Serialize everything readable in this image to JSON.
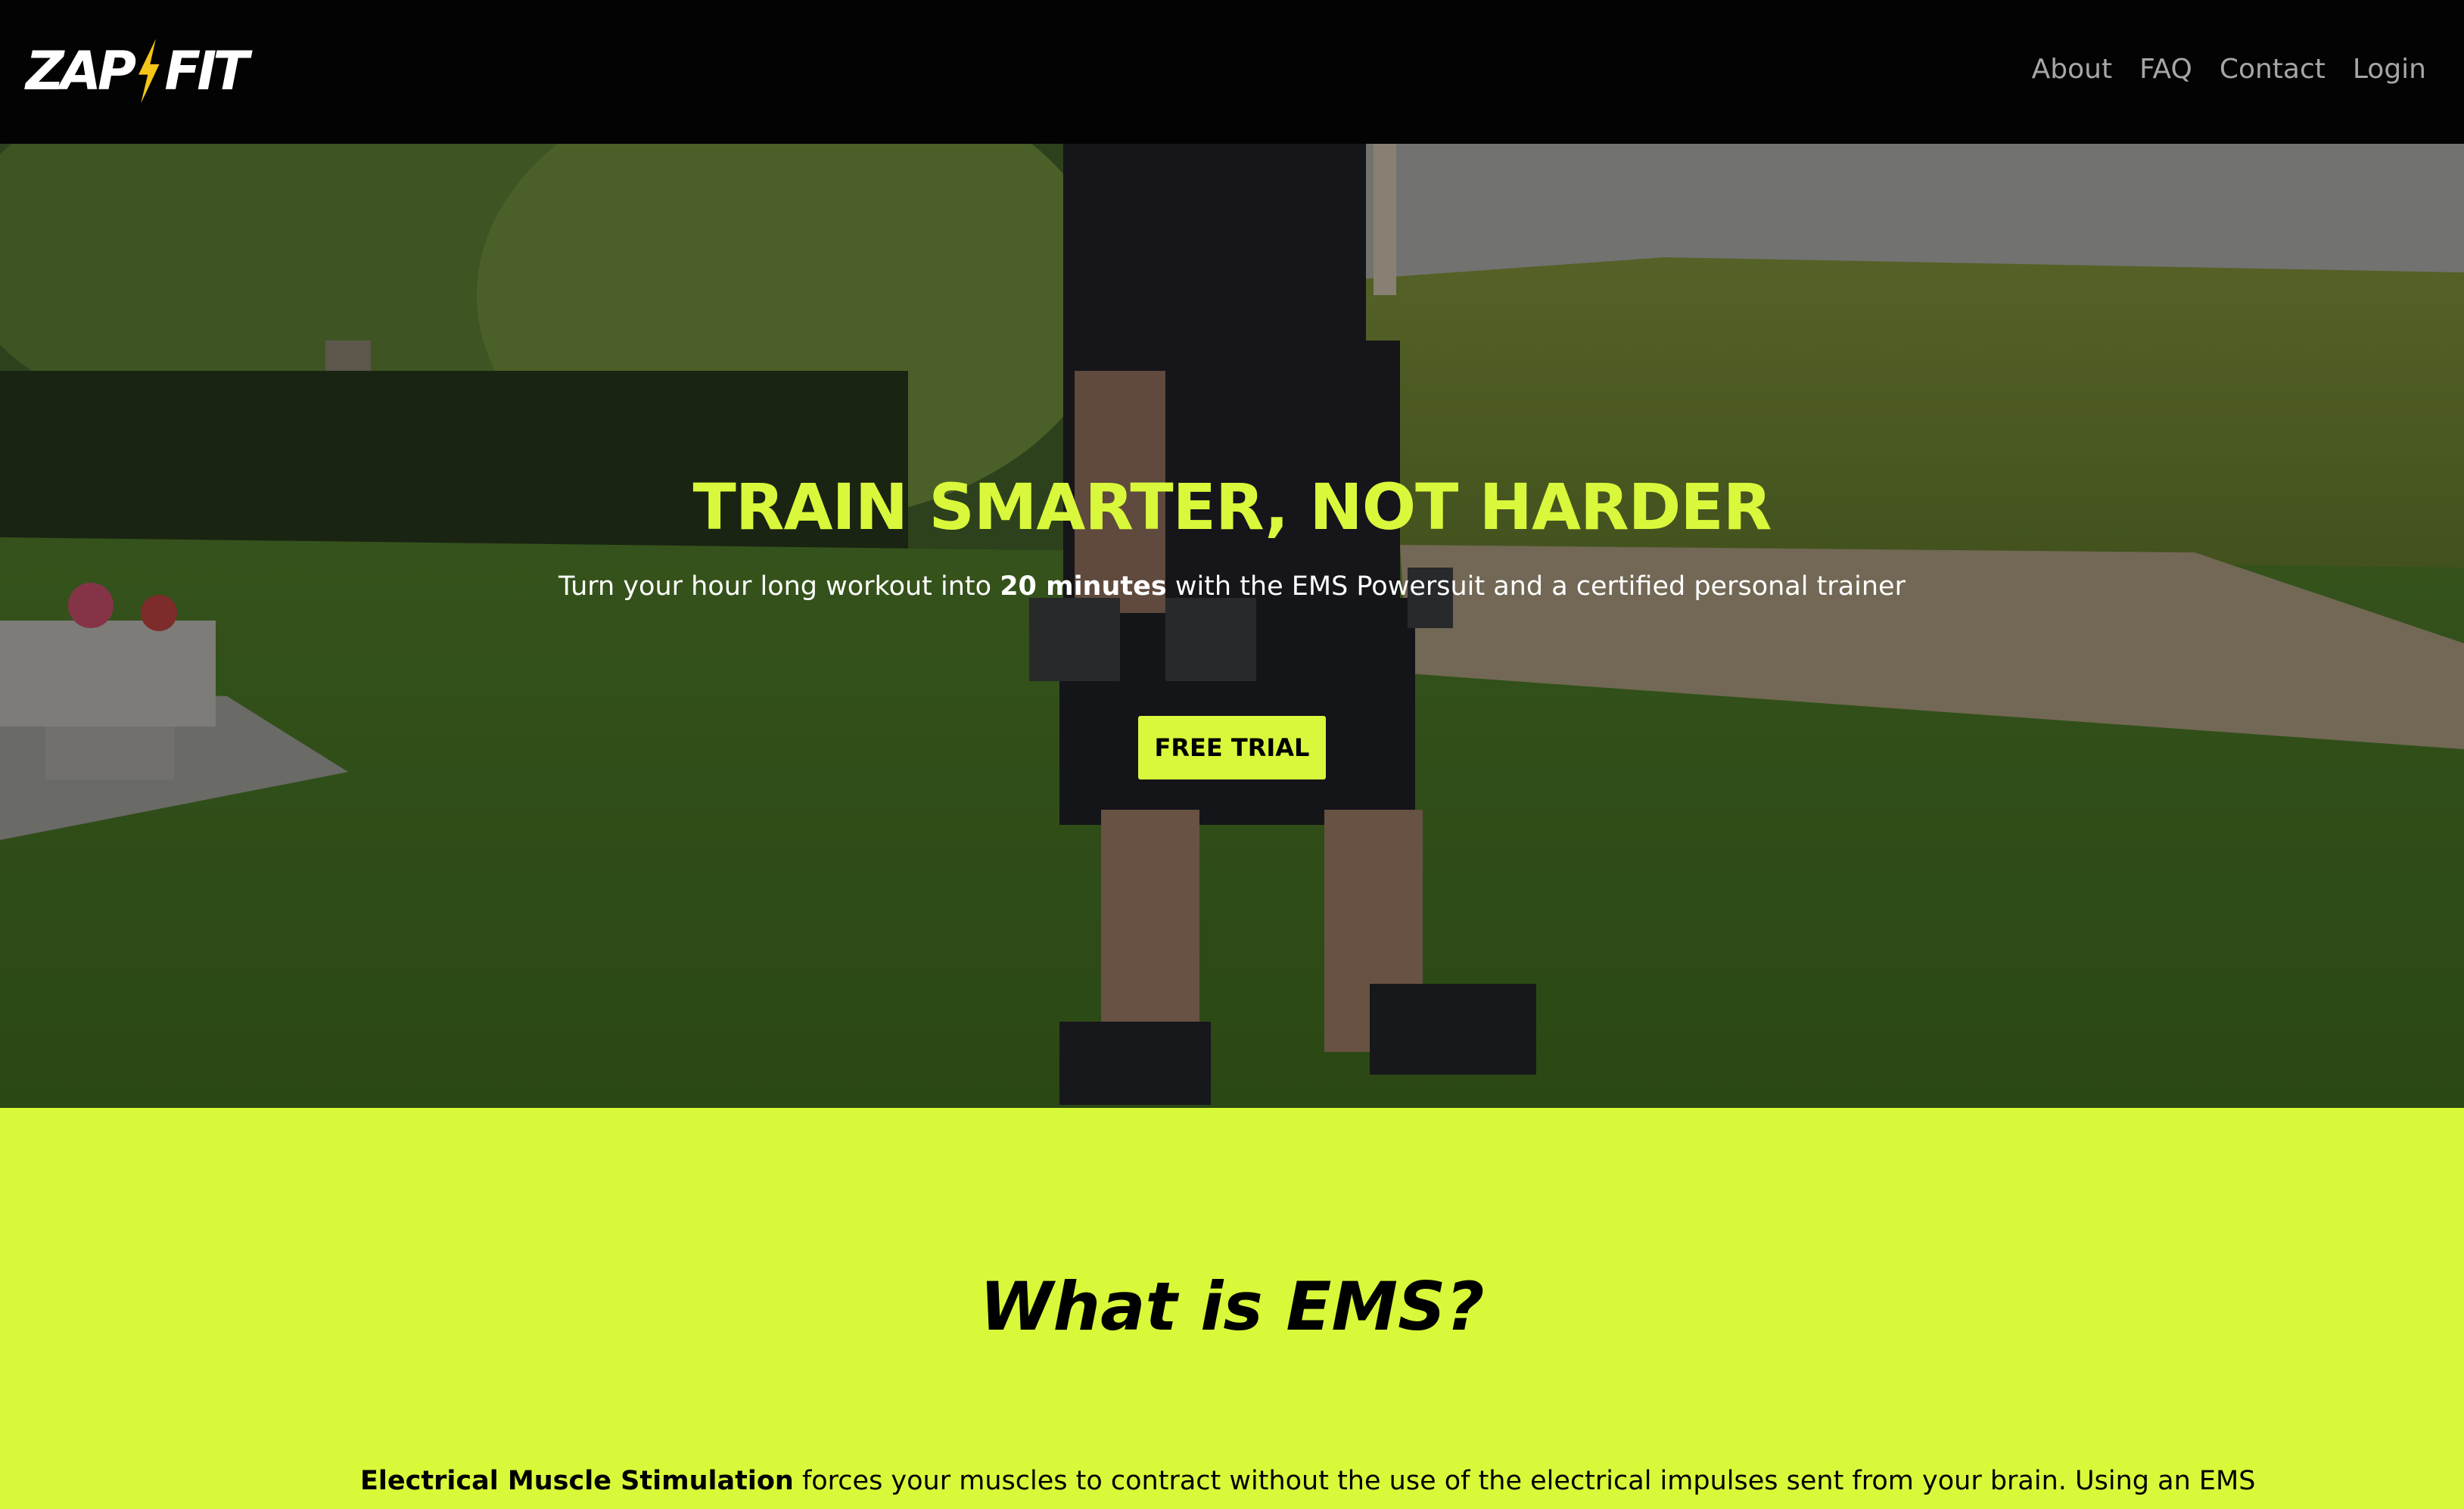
{
  "brand": {
    "logo_left": "ZAP",
    "logo_right": "FIT",
    "accent_color": "#d9f83b",
    "bolt_color": "#f5c518"
  },
  "nav": {
    "items": [
      {
        "label": "About"
      },
      {
        "label": "FAQ"
      },
      {
        "label": "Contact"
      },
      {
        "label": "Login"
      }
    ]
  },
  "hero": {
    "title": "TRAIN SMARTER, NOT HARDER",
    "subtitle_pre": "Turn your hour long workout into ",
    "subtitle_bold": "20 minutes",
    "subtitle_post": " with the EMS Powersuit and a certified personal trainer",
    "cta_label": "FREE TRIAL",
    "background_image": "man in black EMS suit holding dumbbells on a lawn"
  },
  "ems_section": {
    "heading": "What is EMS?",
    "body_bold": "Electrical Muscle Stimulation",
    "body_text": " forces your muscles to contract without the use of the electrical impulses sent from your brain. Using an EMS",
    "background_color": "#d8f83a"
  }
}
